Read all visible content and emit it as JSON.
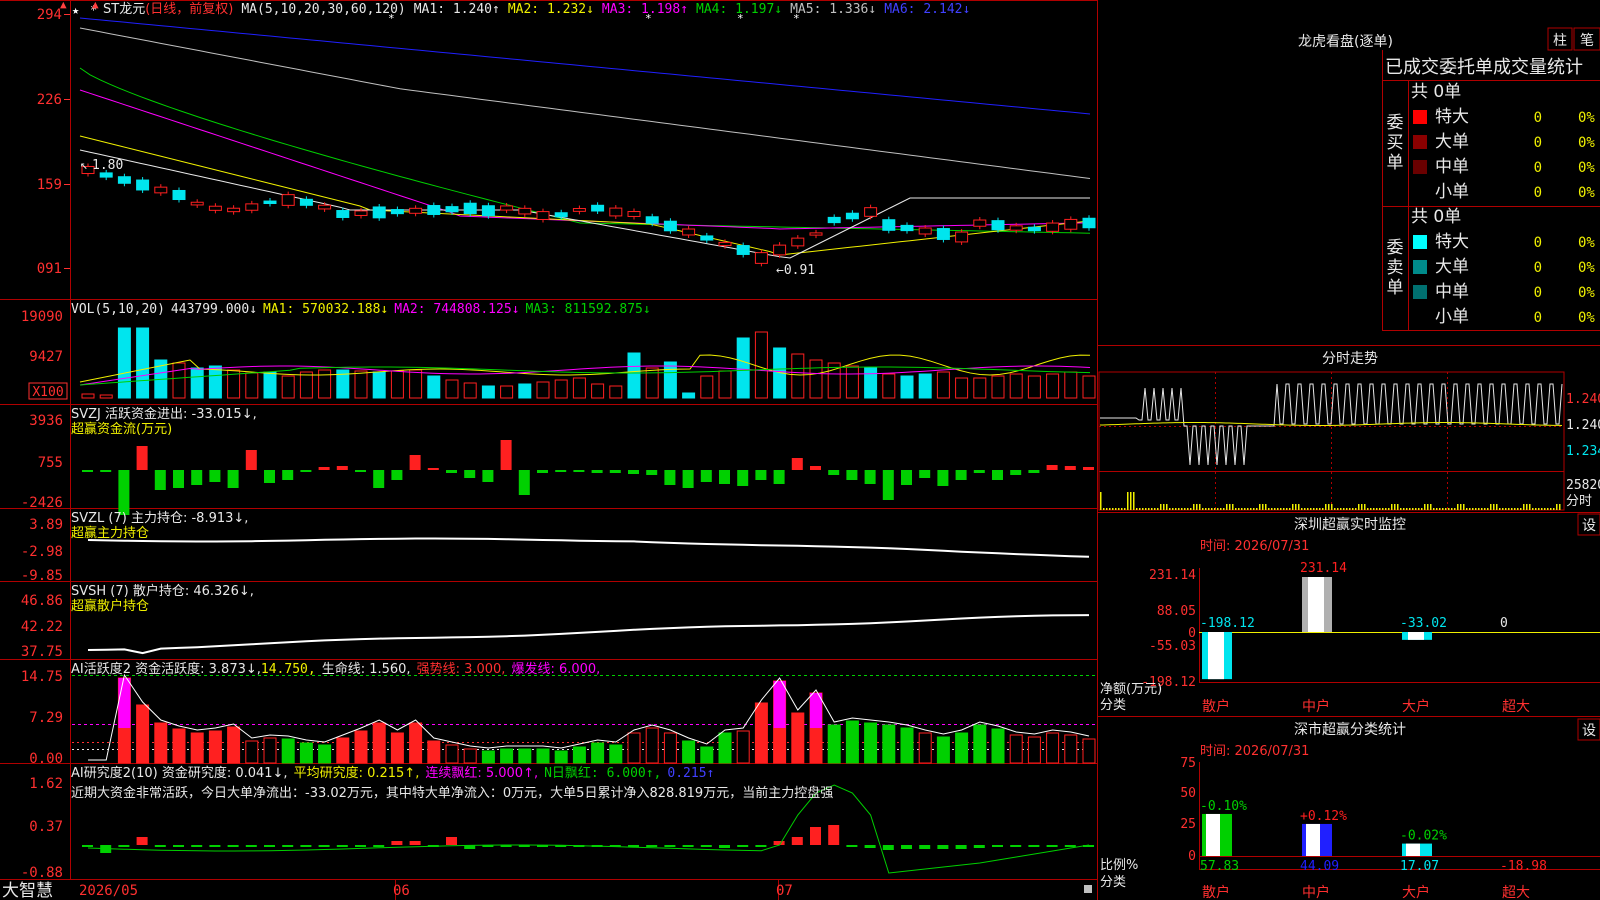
{
  "colors": {
    "up": "#ff2020",
    "down": "#00e5ee",
    "green": "#00d000",
    "frame": "#b00000",
    "white": "#e8e8e8",
    "yellow": "#f0f000",
    "magenta": "#ff00ff",
    "cyan": "#00e5ee",
    "blue": "#2020ff",
    "gray": "#c0c0c0"
  },
  "price": {
    "stock": "ST龙元",
    "mode": "(日线，前复权)",
    "ma_label": "MA(5,10,20,30,60,120)",
    "ma": [
      {
        "label": "MA1: 1.240↑",
        "color": "#e8e8e8"
      },
      {
        "label": "MA2: 1.232↓",
        "color": "#f0f000"
      },
      {
        "label": "MA3: 1.198↑",
        "color": "#ff00ff"
      },
      {
        "label": "MA4: 1.197↓",
        "color": "#00d000"
      },
      {
        "label": "MA5: 1.336↓",
        "color": "#c0c0c0"
      },
      {
        "label": "MA6: 2.142↓",
        "color": "#2020ff"
      }
    ],
    "yticks": [
      "294",
      "226",
      "159",
      "091"
    ],
    "high_label": "1.80",
    "low_label": "←0.91"
  },
  "vol": {
    "label": "VOL(5,10,20)",
    "value": "443799.000↓",
    "ma": [
      {
        "label": "MA1: 570032.188↓",
        "color": "#f0f000"
      },
      {
        "label": "MA2: 744808.125↓",
        "color": "#ff00ff"
      },
      {
        "label": "MA3: 811592.875↓",
        "color": "#00d000"
      }
    ],
    "yticks": [
      "19090",
      "9427"
    ],
    "unit": "X100"
  },
  "svzj": {
    "line1": "SVZJ  活跃资金进出: -33.015↓,",
    "line2": "超赢资金流(万元)",
    "yticks": [
      "3936",
      "755",
      "-2426"
    ]
  },
  "svzl": {
    "line1": "SVZL (7) 主力持仓: -8.913↓,",
    "line2": "超赢主力持仓",
    "yticks": [
      "3.89",
      "-2.98",
      "-9.85"
    ]
  },
  "svsh": {
    "line1": "SVSH (7) 散户持仓: 46.326↓,",
    "line2": "超赢散户持仓",
    "yticks": [
      "46.86",
      "42.22",
      "37.75"
    ]
  },
  "ai1": {
    "name": "AI活跃度2 资金活跃度: 3.873↓,",
    "v2": "14.750,",
    "v3": "生命线: 1.560,",
    "v4": "强势线: 3.000,",
    "v5": "爆发线: 6.000,",
    "yticks": [
      "14.75",
      "7.29",
      "0.00"
    ]
  },
  "ai2": {
    "name": "AI研究度2(10) 资金研究度: 0.041↓,",
    "v2": "平均研究度: 0.215↑,",
    "v3": "连续飘红: 5.000↑,",
    "v4": "N日飘红: 6.000↑,",
    "v5": "0.215↑",
    "note": "近期大资金非常活跃，今日大单净流出：-33.02万元，其中特大单净流入：0万元，大单5日累计净入828.819万元，当前主力控盘强",
    "yticks": [
      "1.62",
      "0.37",
      "-0.88"
    ]
  },
  "xaxis": {
    "labels": [
      "2026/05",
      "06",
      "07"
    ],
    "brand": "大智慧"
  },
  "longhu": {
    "title": "龙虎看盘(逐单)",
    "btn1": "柱",
    "btn2": "笔",
    "header": "已成交委托单成交量统计",
    "buy_label": "委买单",
    "sell_label": "委卖单",
    "total_buy": "共 0单",
    "total_sell": "共 0单",
    "buy_rows": [
      {
        "name": "特大",
        "qty": "0",
        "pct": "0%",
        "color": "#ff0000"
      },
      {
        "name": "大单",
        "qty": "0",
        "pct": "0%",
        "color": "#8b0000"
      },
      {
        "name": "中单",
        "qty": "0",
        "pct": "0%",
        "color": "#6a0000"
      },
      {
        "name": "小单",
        "qty": "0",
        "pct": "0%",
        "color": "#000000"
      }
    ],
    "sell_rows": [
      {
        "name": "特大",
        "qty": "0",
        "pct": "0%",
        "color": "#00ffff"
      },
      {
        "name": "大单",
        "qty": "0",
        "pct": "0%",
        "color": "#008b8b"
      },
      {
        "name": "中单",
        "qty": "0",
        "pct": "0%",
        "color": "#007070"
      },
      {
        "name": "小单",
        "qty": "0",
        "pct": "0%",
        "color": "#000000"
      }
    ]
  },
  "fenshi": {
    "title": "分时走势",
    "y1": "1.240",
    "y2": "1.240",
    "y3": "1.234",
    "vol": "25820",
    "unit": "分时"
  },
  "monitor": {
    "title": "深圳超赢实时监控",
    "btn": "设",
    "time": "时间: 2026/07/31",
    "yticks": [
      "231.14",
      "88.05",
      "0",
      "-55.03",
      "-198.12"
    ],
    "ylabel": "净额(万元)",
    "xlabel": "分类",
    "cats": [
      "散户",
      "中户",
      "大户",
      "超大"
    ],
    "values": [
      -198.12,
      231.14,
      -33.02,
      0
    ],
    "labels": [
      "-198.12",
      "231.14",
      "-33.02",
      "0"
    ]
  },
  "classify": {
    "title": "深市超赢分类统计",
    "btn": "设",
    "time": "时间: 2026/07/31",
    "yticks": [
      "75",
      "50",
      "25",
      "0"
    ],
    "ylabel": "比例%",
    "xlabel": "分类",
    "cats": [
      "散户",
      "中户",
      "大户",
      "超大"
    ],
    "pct_labels": [
      "-0.10%",
      "+0.12%",
      "-0.02%",
      ""
    ],
    "values": [
      57.83,
      44.09,
      17.07,
      -18.98
    ],
    "val_labels": [
      "57.83",
      "44.09",
      "17.07",
      "-18.98"
    ]
  }
}
